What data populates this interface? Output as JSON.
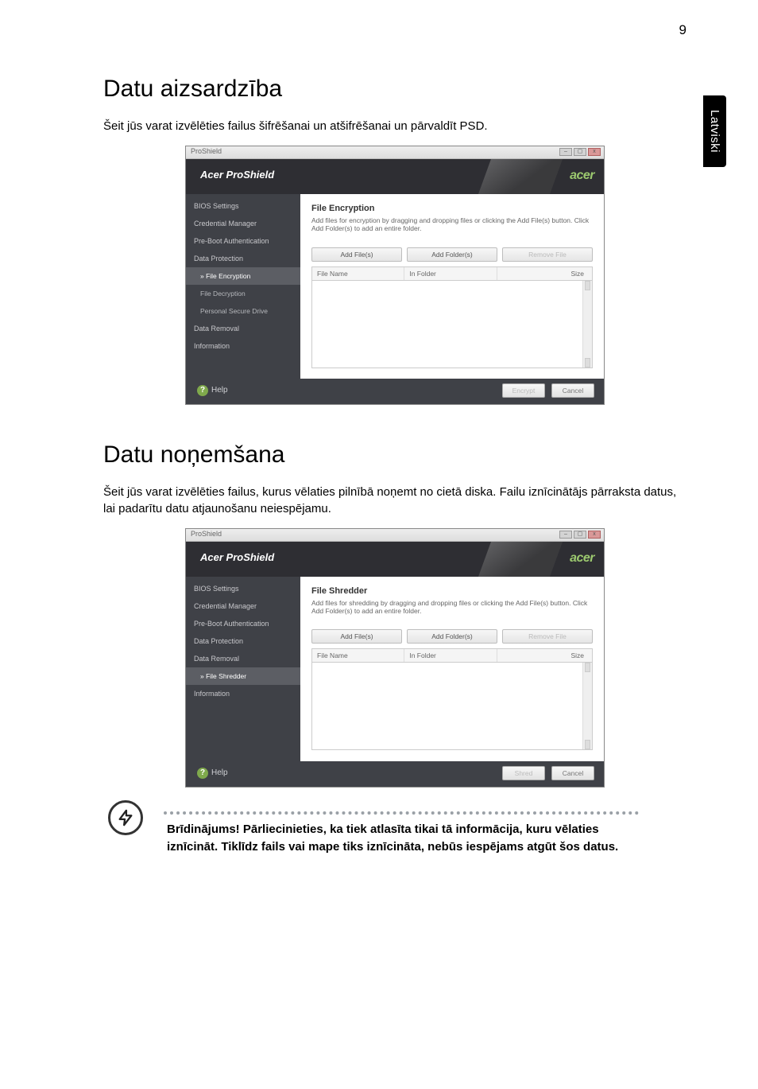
{
  "page_number": "9",
  "side_tab": "Latviski",
  "section1": {
    "heading": "Datu aizsardzība",
    "intro": "Šeit jūs varat izvēlēties failus šifrēšanai un atšifrēšanai un pārvaldīt PSD."
  },
  "section2": {
    "heading": "Datu noņemšana",
    "intro": "Šeit jūs varat izvēlēties failus, kurus vēlaties pilnībā noņemt no cietā diska. Failu iznīcinātājs pārraksta datus, lai padarītu datu atjaunošanu neiespējamu."
  },
  "warning_text": "Brīdinājums! Pārliecinieties, ka tiek atlasīta tikai tā informācija, kuru vēlaties iznīcināt. Tiklīdz fails vai mape tiks iznīcināta, nebūs iespējams atgūt šos datus.",
  "mock_common": {
    "titlebar_name": "ProShield",
    "banner_title": "Acer ProShield",
    "brand": "acer",
    "btn_add_files": "Add File(s)",
    "btn_add_folders": "Add Folder(s)",
    "btn_remove": "Remove File",
    "col_name": "File Name",
    "col_folder": "In Folder",
    "col_size": "Size",
    "help": "Help",
    "btn_cancel": "Cancel"
  },
  "mock_enc": {
    "main_title": "File Encryption",
    "main_desc": "Add files for encryption by dragging and dropping files or clicking the Add File(s) button. Click Add Folder(s) to add an entire folder.",
    "btn_primary": "Encrypt",
    "sidebar": [
      {
        "label": "BIOS Settings",
        "sub": false,
        "active": false
      },
      {
        "label": "Credential Manager",
        "sub": false,
        "active": false
      },
      {
        "label": "Pre-Boot Authentication",
        "sub": false,
        "active": false
      },
      {
        "label": "Data Protection",
        "sub": false,
        "active": false
      },
      {
        "label": "» File Encryption",
        "sub": true,
        "active": true
      },
      {
        "label": "File Decryption",
        "sub": true,
        "active": false
      },
      {
        "label": "Personal Secure Drive",
        "sub": true,
        "active": false
      },
      {
        "label": "Data Removal",
        "sub": false,
        "active": false
      },
      {
        "label": "Information",
        "sub": false,
        "active": false
      }
    ]
  },
  "mock_shred": {
    "main_title": "File Shredder",
    "main_desc": "Add files for shredding by dragging and dropping files or clicking the Add File(s) button. Click Add Folder(s) to add an entire folder.",
    "btn_primary": "Shred",
    "sidebar": [
      {
        "label": "BIOS Settings",
        "sub": false,
        "active": false
      },
      {
        "label": "Credential Manager",
        "sub": false,
        "active": false
      },
      {
        "label": "Pre-Boot Authentication",
        "sub": false,
        "active": false
      },
      {
        "label": "Data Protection",
        "sub": false,
        "active": false
      },
      {
        "label": "Data Removal",
        "sub": false,
        "active": false
      },
      {
        "label": "» File Shredder",
        "sub": true,
        "active": true
      },
      {
        "label": "Information",
        "sub": false,
        "active": false
      }
    ]
  }
}
